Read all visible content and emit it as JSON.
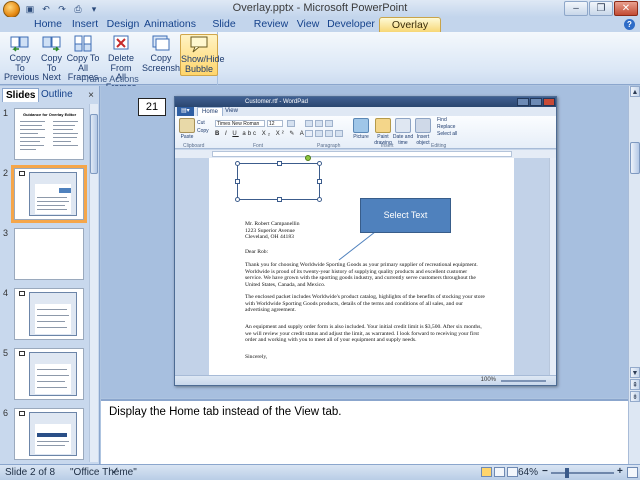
{
  "window": {
    "title": "Overlay.pptx - Microsoft PowerPoint",
    "controls": [
      "–",
      "❐",
      "✕"
    ]
  },
  "ribbon_tabs": [
    {
      "label": "Home"
    },
    {
      "label": "Insert"
    },
    {
      "label": "Design"
    },
    {
      "label": "Animations"
    },
    {
      "label": "Slide Show"
    },
    {
      "label": "Review"
    },
    {
      "label": "View"
    },
    {
      "label": "Developer"
    },
    {
      "label": "Overlay Editor",
      "active": true
    }
  ],
  "ribbon_group": {
    "label": "Frame Actions",
    "buttons": [
      {
        "line1": "Copy To",
        "line2": "Previous",
        "icon": "copy-to-previous-icon"
      },
      {
        "line1": "Copy",
        "line2": "To Next",
        "icon": "copy-to-next-icon"
      },
      {
        "line1": "Copy To",
        "line2": "All Frames",
        "icon": "copy-to-all-icon"
      },
      {
        "line1": "Delete From",
        "line2": "All Frames",
        "icon": "delete-from-all-icon"
      },
      {
        "line1": "Copy",
        "line2": "Screenshot",
        "icon": "copy-screenshot-icon"
      },
      {
        "line1": "Show/Hide",
        "line2": "Bubble",
        "icon": "speech-bubble-icon",
        "active": true
      }
    ]
  },
  "slides_pane": {
    "tabs": [
      "Slides",
      "Outline"
    ],
    "close": "×",
    "thumbnails": [
      {
        "number": "1",
        "title": "Guidance for Overlay Editor"
      },
      {
        "number": "2",
        "selected": true
      },
      {
        "number": "3"
      },
      {
        "number": "4"
      },
      {
        "number": "5"
      },
      {
        "number": "6"
      }
    ]
  },
  "slide": {
    "frame_number": "21",
    "callout_text": "Select Text"
  },
  "wordpad": {
    "title": "Customer.rtf - WordPad",
    "tabs": [
      "Home",
      "View"
    ],
    "font_name": "Times New Roman",
    "font_size": "12",
    "groups": [
      "Clipboard",
      "Font",
      "Paragraph",
      "Insert",
      "Editing"
    ],
    "buttons": {
      "paste": "Paste",
      "cut": "Cut",
      "copy": "Copy",
      "picture": "Picture",
      "paint": "Paint drawing",
      "datetime": "Date and time",
      "object": "Insert object",
      "find": "Find",
      "replace": "Replace",
      "selectall": "Select all"
    },
    "zoom": "100%",
    "document": {
      "address": [
        "Mr. Robert Campanellin",
        "1223 Superior Avenue",
        "Cleveland, OH  44183"
      ],
      "greeting": "Dear Rob:",
      "p1": "Thank you for choosing Worldwide Sporting Goods as your primary supplier of recreational equipment. Worldwide is proud of its twenty-year history of supplying quality products and excellent customer service. We have grown with the sporting goods industry, and currently serve customers throughout the United States, Canada, and Mexico.",
      "p2": "The enclosed packet includes Worldwide's product catalog, highlights of the benefits of stocking your store with Worldwide Sporting Goods products, details of the terms and conditions of all sales, and our advertising agreement.",
      "p3": "An equipment and supply order form is also included. Your initial credit limit is $3,500. After six months, we will review your credit status and adjust the limit, as warranted. I look forward to receiving your first order and working with you to meet all of your equipment and supply needs.",
      "closing": "Sincerely,"
    }
  },
  "notes": {
    "text": "Display the Home tab instead of the View tab."
  },
  "statusbar": {
    "slide_info": "Slide 2 of 8",
    "theme": "\"Office Theme\"",
    "zoom": "64%",
    "zoom_minus": "−",
    "zoom_plus": "+"
  },
  "colors": {
    "accent": "#4f81bd",
    "active_button": "#ffd56b",
    "selected_thumbnail": "#f5a64a"
  }
}
